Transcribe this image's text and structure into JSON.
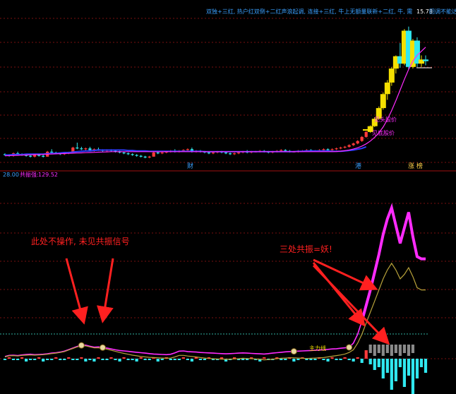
{
  "colors": {
    "up": "#ff3b3b",
    "down": "#30e8f0",
    "yellow": "#f5e000",
    "ma": "#2b3cff",
    "magenta": "#ff2bff",
    "olive": "#b8a23a",
    "grid": "#7a1010",
    "annotation": "#ff2020",
    "label_blue": "#3aa0ff",
    "axis_label": "#2aa6ff"
  },
  "top_panel": {
    "legend": {
      "text": "双独+三红, 热户红双倒+二红声浪起调, 连接+三红, 牛上无额量联新+二红, 牛, 需",
      "price": "15.78",
      "tail": "回调不能达"
    },
    "price_tag": "15.78",
    "annotations": [
      "见头股价",
      "见底股价"
    ],
    "bottom_labels": [
      {
        "text": "财",
        "color": "#3aa0ff"
      },
      {
        "text": "港",
        "color": "#3aa0ff"
      },
      {
        "text": "涨 榜",
        "color": "#ffd24a"
      }
    ]
  },
  "bottom_panel": {
    "header": {
      "value1": "28.00",
      "label": "共振强:",
      "value2": "129.52"
    },
    "annotation_left": "此处不操作, 未见共振信号",
    "annotation_right": "三处共振=妖!",
    "signal_label": "主力线"
  },
  "chart_data": {
    "type": "line",
    "title": "",
    "xlabel": "",
    "ylabel": "",
    "x_count": 100,
    "candles": [
      [
        10.0,
        10.1,
        9.8,
        9.9
      ],
      [
        9.9,
        10.0,
        9.7,
        9.8
      ],
      [
        9.8,
        10.2,
        9.7,
        10.1
      ],
      [
        10.1,
        10.3,
        9.9,
        10.0
      ],
      [
        10.0,
        10.1,
        9.8,
        9.9
      ],
      [
        9.9,
        10.0,
        9.7,
        9.8
      ],
      [
        9.8,
        10.0,
        9.6,
        9.7
      ],
      [
        9.7,
        9.9,
        9.6,
        9.9
      ],
      [
        9.9,
        10.0,
        9.7,
        9.8
      ],
      [
        9.8,
        9.9,
        9.6,
        9.7
      ],
      [
        9.7,
        10.4,
        9.7,
        10.3
      ],
      [
        10.3,
        10.6,
        10.1,
        10.2
      ],
      [
        10.2,
        10.3,
        10.0,
        10.1
      ],
      [
        10.1,
        10.2,
        9.9,
        10.0
      ],
      [
        10.0,
        10.2,
        9.9,
        10.1
      ],
      [
        10.1,
        10.3,
        10.0,
        10.2
      ],
      [
        10.2,
        10.9,
        10.1,
        10.8
      ],
      [
        10.8,
        11.4,
        10.6,
        10.7
      ],
      [
        10.7,
        10.9,
        10.5,
        10.6
      ],
      [
        10.6,
        10.8,
        10.4,
        10.7
      ],
      [
        10.7,
        10.9,
        10.4,
        10.5
      ],
      [
        10.5,
        10.7,
        10.3,
        10.6
      ],
      [
        10.6,
        10.8,
        10.4,
        10.5
      ],
      [
        10.5,
        10.6,
        10.3,
        10.4
      ],
      [
        10.4,
        10.6,
        10.3,
        10.5
      ],
      [
        10.5,
        10.6,
        10.3,
        10.4
      ],
      [
        10.4,
        10.5,
        10.2,
        10.3
      ],
      [
        10.3,
        10.4,
        10.1,
        10.2
      ],
      [
        10.2,
        10.3,
        10.0,
        10.1
      ],
      [
        10.1,
        10.2,
        9.9,
        10.0
      ],
      [
        10.0,
        10.1,
        9.8,
        9.9
      ],
      [
        9.9,
        10.0,
        9.7,
        9.8
      ],
      [
        9.8,
        9.9,
        9.6,
        9.7
      ],
      [
        9.7,
        9.8,
        9.5,
        9.6
      ],
      [
        9.6,
        9.8,
        9.5,
        9.7
      ],
      [
        9.7,
        10.3,
        9.7,
        10.2
      ],
      [
        10.2,
        10.4,
        10.0,
        10.1
      ],
      [
        10.1,
        10.3,
        10.0,
        10.2
      ],
      [
        10.2,
        10.4,
        10.1,
        10.3
      ],
      [
        10.3,
        10.5,
        10.2,
        10.4
      ],
      [
        10.4,
        10.6,
        10.2,
        10.3
      ],
      [
        10.3,
        10.5,
        10.2,
        10.4
      ],
      [
        10.4,
        10.6,
        10.3,
        10.5
      ],
      [
        10.5,
        10.7,
        10.4,
        10.6
      ],
      [
        10.6,
        10.8,
        10.2,
        10.3
      ],
      [
        10.3,
        10.5,
        10.2,
        10.4
      ],
      [
        10.4,
        10.5,
        10.2,
        10.3
      ],
      [
        10.3,
        10.4,
        10.1,
        10.2
      ],
      [
        10.2,
        10.3,
        10.0,
        10.1
      ],
      [
        10.1,
        10.3,
        10.0,
        10.2
      ],
      [
        10.2,
        10.4,
        10.1,
        10.3
      ],
      [
        10.3,
        10.4,
        10.1,
        10.2
      ],
      [
        10.2,
        10.3,
        10.0,
        10.1
      ],
      [
        10.1,
        10.2,
        9.9,
        10.0
      ],
      [
        10.0,
        10.2,
        9.9,
        10.1
      ],
      [
        10.1,
        10.3,
        10.0,
        10.2
      ],
      [
        10.2,
        10.4,
        10.1,
        10.3
      ],
      [
        10.3,
        10.5,
        10.1,
        10.2
      ],
      [
        10.2,
        10.4,
        10.1,
        10.3
      ],
      [
        10.3,
        10.4,
        10.2,
        10.3
      ],
      [
        10.3,
        10.5,
        10.2,
        10.4
      ],
      [
        10.4,
        10.5,
        10.2,
        10.3
      ],
      [
        10.3,
        10.4,
        10.1,
        10.2
      ],
      [
        10.2,
        10.4,
        10.1,
        10.3
      ],
      [
        10.3,
        10.5,
        10.2,
        10.4
      ],
      [
        10.4,
        10.6,
        10.3,
        10.5
      ],
      [
        10.5,
        10.6,
        10.3,
        10.4
      ],
      [
        10.4,
        10.5,
        10.2,
        10.3
      ],
      [
        10.3,
        10.4,
        10.2,
        10.3
      ],
      [
        10.3,
        10.5,
        10.2,
        10.4
      ],
      [
        10.4,
        10.5,
        10.3,
        10.4
      ],
      [
        10.4,
        10.6,
        10.3,
        10.5
      ],
      [
        10.5,
        10.6,
        10.3,
        10.4
      ],
      [
        10.4,
        10.5,
        10.3,
        10.4
      ],
      [
        10.4,
        10.6,
        10.3,
        10.5
      ],
      [
        10.5,
        10.7,
        10.4,
        10.6
      ],
      [
        10.6,
        10.7,
        10.4,
        10.5
      ],
      [
        10.5,
        10.7,
        10.4,
        10.6
      ],
      [
        10.6,
        10.8,
        10.5,
        10.7
      ],
      [
        10.7,
        10.9,
        10.6,
        10.8
      ],
      [
        10.8,
        11.0,
        10.7,
        10.9
      ],
      [
        10.9,
        11.2,
        10.8,
        11.1
      ],
      [
        11.1,
        11.4,
        11.0,
        11.3
      ],
      [
        11.3,
        11.7,
        11.2,
        11.6
      ],
      [
        11.6,
        12.2,
        11.5,
        12.1
      ],
      [
        12.1,
        12.8,
        12.0,
        12.7
      ],
      [
        12.7,
        13.5,
        12.6,
        13.4
      ],
      [
        13.4,
        14.5,
        13.3,
        14.3
      ],
      [
        14.3,
        15.8,
        14.2,
        15.6
      ],
      [
        15.6,
        17.5,
        15.4,
        17.3
      ],
      [
        17.3,
        19.0,
        16.6,
        18.7
      ],
      [
        18.7,
        20.6,
        18.3,
        20.4
      ],
      [
        20.4,
        22.0,
        19.8,
        21.9
      ],
      [
        21.9,
        23.5,
        20.5,
        21.0
      ],
      [
        21.0,
        25.2,
        20.8,
        25.0
      ],
      [
        25.0,
        25.5,
        20.3,
        20.6
      ],
      [
        20.6,
        24.0,
        20.4,
        23.8
      ],
      [
        23.8,
        24.2,
        20.6,
        21.0
      ],
      [
        21.0,
        22.0,
        20.6,
        21.5
      ],
      [
        21.5,
        22.0,
        20.8,
        21.3
      ]
    ],
    "series": [
      {
        "name": "",
        "role": "ma-blue",
        "panel": "top",
        "values": [
          9.9,
          9.9,
          9.95,
          9.95,
          9.95,
          10.0,
          10.0,
          10.0,
          10.0,
          10.0,
          10.05,
          10.1,
          10.1,
          10.15,
          10.2,
          10.2,
          10.25,
          10.3,
          10.35,
          10.4,
          10.4,
          10.45,
          10.5,
          10.5,
          10.5,
          10.5,
          10.5,
          10.5,
          10.5,
          10.45,
          10.45,
          10.4,
          10.4,
          10.4,
          10.35,
          10.35,
          10.35,
          10.35,
          10.35,
          10.35,
          10.35,
          10.35,
          10.35,
          10.35,
          10.35,
          10.35,
          10.35,
          10.3,
          10.3,
          10.3,
          10.3,
          10.3,
          10.3,
          10.3,
          10.3,
          10.3,
          10.3,
          10.3,
          10.3,
          10.3,
          10.3,
          10.3,
          10.3,
          10.3,
          10.3,
          10.3,
          10.3,
          10.3,
          10.3,
          10.35,
          10.35,
          10.4,
          10.4,
          10.4,
          10.4,
          10.4,
          10.4,
          10.35,
          10.35,
          10.35,
          10.4,
          10.45,
          10.5,
          10.6,
          10.7,
          10.9,
          null,
          null,
          null,
          null,
          null,
          null,
          null,
          null,
          null,
          null,
          null,
          null,
          null,
          null
        ]
      },
      {
        "name": "",
        "role": "ma-magenta",
        "panel": "top",
        "values": [
          9.8,
          9.82,
          9.84,
          9.86,
          9.88,
          9.9,
          9.92,
          9.94,
          9.96,
          9.98,
          10.0,
          10.02,
          10.04,
          10.06,
          10.08,
          10.1,
          10.12,
          10.14,
          10.16,
          10.18,
          10.2,
          10.22,
          10.24,
          10.26,
          10.28,
          10.3,
          10.3,
          10.3,
          10.3,
          10.3,
          10.3,
          10.3,
          10.3,
          10.3,
          10.3,
          10.3,
          10.3,
          10.3,
          10.3,
          10.3,
          10.3,
          10.3,
          10.3,
          10.3,
          10.3,
          10.3,
          10.3,
          10.3,
          10.3,
          10.3,
          10.3,
          10.3,
          10.3,
          10.3,
          10.3,
          10.3,
          10.3,
          10.3,
          10.3,
          10.3,
          10.3,
          10.3,
          10.3,
          10.3,
          10.3,
          10.3,
          10.3,
          10.3,
          10.3,
          10.3,
          10.3,
          10.3,
          10.3,
          10.3,
          10.3,
          10.3,
          10.3,
          10.3,
          10.32,
          10.36,
          10.42,
          10.5,
          10.62,
          10.78,
          10.98,
          11.25,
          11.6,
          12.05,
          12.6,
          13.3,
          14.2,
          15.3,
          16.5,
          17.8,
          19.1,
          20.3,
          21.3,
          22.0,
          22.5,
          23.0
        ]
      },
      {
        "name": "",
        "role": "resonance-magenta",
        "panel": "bottom",
        "values": [
          2.0,
          3.0,
          3.2,
          2.8,
          3.4,
          3.8,
          4.0,
          3.6,
          3.8,
          4.0,
          4.4,
          5.0,
          5.4,
          6.0,
          6.8,
          8.2,
          9.6,
          11.0,
          12.0,
          12.2,
          11.2,
          10.4,
          10.6,
          10.0,
          9.6,
          8.8,
          8.0,
          7.4,
          7.0,
          6.6,
          6.2,
          5.8,
          5.4,
          5.0,
          4.6,
          4.2,
          4.0,
          3.8,
          3.6,
          4.0,
          5.2,
          6.8,
          7.0,
          6.4,
          6.2,
          6.0,
          5.6,
          5.4,
          5.2,
          5.0,
          4.8,
          4.6,
          4.4,
          4.6,
          4.8,
          5.0,
          5.2,
          5.0,
          4.8,
          4.6,
          4.4,
          4.2,
          4.6,
          5.0,
          5.4,
          5.8,
          6.2,
          6.4,
          6.6,
          6.8,
          7.0,
          7.2,
          7.4,
          7.6,
          7.8,
          8.0,
          8.4,
          8.8,
          9.0,
          9.4,
          9.8,
          10.2,
          14.0,
          22.0,
          34.0,
          48.0,
          62.0,
          78.0,
          94.0,
          112.0,
          126.0,
          136.0,
          120.0,
          104.0,
          118.0,
          132.0,
          110.0,
          92.0,
          90.0,
          90.0
        ]
      },
      {
        "name": "",
        "role": "resonance-olive",
        "panel": "bottom",
        "values": [
          1.6,
          2.6,
          2.8,
          2.4,
          3.0,
          3.2,
          3.4,
          3.2,
          3.4,
          3.6,
          4.0,
          4.6,
          5.0,
          5.6,
          6.4,
          7.8,
          9.2,
          10.6,
          11.4,
          11.6,
          10.6,
          9.8,
          9.8,
          9.2,
          8.6,
          7.6,
          6.6,
          5.6,
          4.8,
          4.0,
          3.2,
          2.6,
          2.0,
          1.6,
          1.2,
          1.0,
          0.8,
          0.6,
          0.4,
          0.6,
          1.6,
          3.0,
          3.0,
          2.4,
          2.0,
          1.6,
          1.0,
          0.6,
          0.2,
          0.0,
          -0.2,
          -0.4,
          -0.6,
          -0.4,
          -0.2,
          0.0,
          0.4,
          0.2,
          0.0,
          -0.2,
          -0.6,
          -1.0,
          -0.8,
          -0.4,
          0.0,
          0.4,
          0.6,
          0.8,
          0.8,
          0.6,
          0.4,
          0.2,
          0.4,
          0.6,
          0.8,
          1.0,
          1.6,
          2.2,
          2.8,
          3.4,
          4.2,
          5.6,
          8.0,
          14.0,
          22.0,
          32.0,
          42.0,
          52.0,
          62.0,
          72.0,
          80.0,
          86.0,
          80.0,
          72.0,
          76.0,
          82.0,
          74.0,
          64.0,
          62.0,
          62.0
        ]
      }
    ],
    "histogram": [
      -1,
      1,
      -1,
      -1,
      1,
      -2,
      -1,
      -1,
      1,
      -2,
      -1,
      -1,
      1,
      -1,
      -1,
      1,
      -1,
      -1,
      1,
      -2,
      -1,
      -2,
      1,
      -1,
      -1,
      1,
      -1,
      -2,
      1,
      -1,
      -1,
      -2,
      1,
      -1,
      -1,
      1,
      -2,
      -1,
      1,
      -1,
      -1,
      -1,
      1,
      -1,
      -2,
      1,
      -1,
      -1,
      1,
      -1,
      -1,
      1,
      -2,
      -1,
      1,
      -1,
      -1,
      -1,
      1,
      -1,
      -2,
      1,
      -1,
      -1,
      1,
      -1,
      -1,
      1,
      -2,
      -1,
      1,
      -1,
      -1,
      -1,
      1,
      -1,
      -2,
      1,
      -1,
      -1,
      1,
      -1,
      -2,
      1,
      -3,
      6,
      -4,
      -8,
      -6,
      -14,
      -10,
      -22,
      -16,
      -6,
      -20,
      -12,
      -26,
      -14,
      -6,
      -10
    ],
    "grey_bars": [
      0,
      0,
      0,
      0,
      0,
      0,
      0,
      0,
      0,
      0,
      0,
      0,
      0,
      0,
      0,
      0,
      0,
      0,
      0,
      0,
      0,
      0,
      0,
      0,
      0,
      0,
      0,
      0,
      0,
      0,
      0,
      0,
      0,
      0,
      0,
      0,
      0,
      0,
      0,
      0,
      0,
      0,
      0,
      0,
      0,
      0,
      0,
      0,
      0,
      0,
      0,
      0,
      0,
      0,
      0,
      0,
      0,
      0,
      0,
      0,
      0,
      0,
      0,
      0,
      0,
      0,
      0,
      0,
      0,
      0,
      0,
      0,
      0,
      0,
      0,
      0,
      0,
      0,
      0,
      0,
      0,
      0,
      0,
      0,
      0,
      0,
      3,
      4,
      3,
      4,
      3,
      4,
      3,
      4,
      3,
      4,
      3,
      0,
      0,
      0
    ],
    "signals": [
      {
        "index": 18,
        "panel": "bottom"
      },
      {
        "index": 23,
        "panel": "bottom"
      },
      {
        "index": 81,
        "panel": "bottom"
      },
      {
        "index": 68,
        "panel": "bottom",
        "label": "主力线"
      }
    ],
    "top_ylim": [
      9.0,
      26.5
    ],
    "bottom_ylim": [
      -30,
      140
    ]
  }
}
